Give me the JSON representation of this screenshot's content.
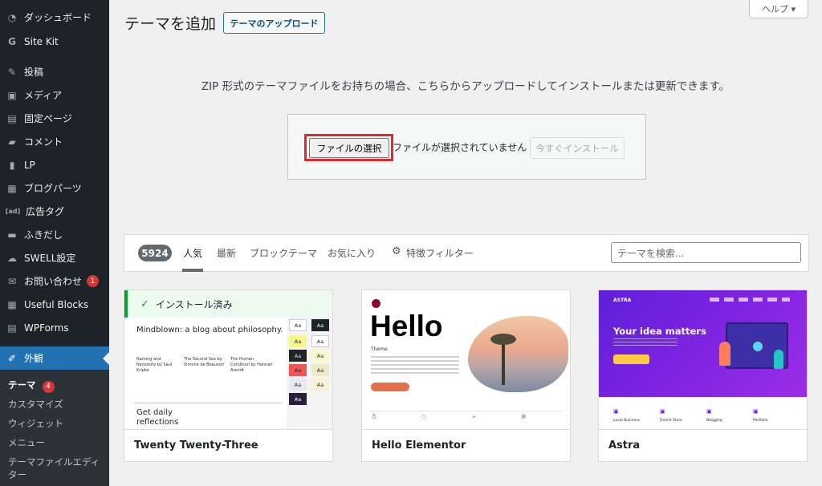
{
  "sidebar": {
    "items": [
      {
        "label": "ダッシュボード",
        "icon": "dashboard-icon"
      },
      {
        "label": "Site Kit",
        "icon": "sitekit-g-icon"
      },
      {
        "label": "投稿",
        "icon": "pin-icon"
      },
      {
        "label": "メディア",
        "icon": "media-icon"
      },
      {
        "label": "固定ページ",
        "icon": "pages-icon"
      },
      {
        "label": "コメント",
        "icon": "comment-icon"
      },
      {
        "label": "LP",
        "icon": "document-icon"
      },
      {
        "label": "ブログパーツ",
        "icon": "blocks-grid-icon"
      },
      {
        "label": "広告タグ",
        "icon": "ad-icon"
      },
      {
        "label": "ふきだし",
        "icon": "speech-bubble-icon"
      },
      {
        "label": "SWELL設定",
        "icon": "swell-icon"
      },
      {
        "label": "お問い合わせ",
        "icon": "mail-icon",
        "badge": "1"
      },
      {
        "label": "Useful Blocks",
        "icon": "grid-icon"
      },
      {
        "label": "WPForms",
        "icon": "forms-icon"
      },
      {
        "label": "外観",
        "icon": "paintbrush-icon"
      }
    ],
    "submenu": [
      {
        "label": "テーマ",
        "badge": "4"
      },
      {
        "label": "カスタマイズ"
      },
      {
        "label": "ウィジェット"
      },
      {
        "label": "メニュー"
      },
      {
        "label": "テーマファイルエディ"
      },
      {
        "label": "ター"
      }
    ]
  },
  "header": {
    "title": "テーマを追加",
    "upload_button": "テーマのアップロード",
    "help_button": "ヘルプ ▾"
  },
  "upload": {
    "description": "ZIP 形式のテーマファイルをお持ちの場合、こちらからアップロードしてインストールまたは更新できます。",
    "file_button": "ファイルの選択",
    "no_file_text": "ファイルが選択されていません",
    "install_button": "今すぐインストール"
  },
  "filter": {
    "count": "5924",
    "tabs": [
      "人気",
      "最新",
      "ブロックテーマ",
      "お気に入り"
    ],
    "feature_filter": "特徴フィルター",
    "search_placeholder": "テーマを検索..."
  },
  "themes": [
    {
      "name": "Twenty Twenty-Three",
      "installed_label": "インストール済み",
      "preview": {
        "headline": "Mindblown: a blog about philosophy.",
        "cols": [
          "Naming and Necessity by Saul Kripke",
          "The Second Sex by Simone de Beauvoir",
          "The Human Condition by Hannah Arendt"
        ],
        "big": [
          "Get daily",
          "reflections"
        ],
        "swatch": "Aa"
      }
    },
    {
      "name": "Hello Elementor",
      "preview": {
        "hello": "Hello",
        "theme": "Theme"
      }
    },
    {
      "name": "Astra",
      "preview": {
        "logo": "ASTRA",
        "headline": "Your idea matters",
        "features": [
          "Local Business",
          "Online Store",
          "Blogging",
          "Portfolio"
        ]
      }
    }
  ],
  "colors": {
    "sidebar_bg": "#1d2327",
    "accent": "#2271b1",
    "highlight_red": "#e2282d",
    "installed_green": "#00a32a",
    "badge_red": "#d63638"
  }
}
